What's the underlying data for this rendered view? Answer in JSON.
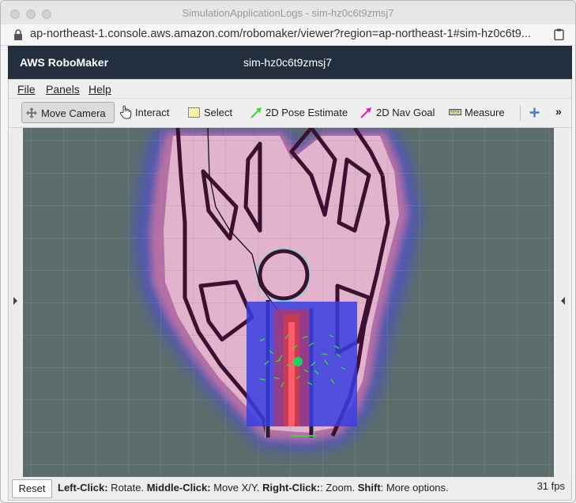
{
  "window": {
    "title": "SimulationApplicationLogs - sim-hz0c6t9zmsj7"
  },
  "address_bar": {
    "url": "ap-northeast-1.console.aws.amazon.com/robomaker/viewer?region=ap-northeast-1#sim-hz0c6t9..."
  },
  "header": {
    "brand": "AWS RoboMaker",
    "simulation": "sim-hz0c6t9zmsj7"
  },
  "menubar": {
    "items": [
      {
        "label": "File"
      },
      {
        "label": "Panels"
      },
      {
        "label": "Help"
      }
    ]
  },
  "toolbar": {
    "tools": [
      {
        "label": "Move Camera",
        "active": true
      },
      {
        "label": "Interact"
      },
      {
        "label": "Select"
      },
      {
        "label": "2D Pose Estimate"
      },
      {
        "label": "2D Nav Goal"
      },
      {
        "label": "Measure"
      }
    ],
    "add_icon": "plus-icon",
    "overflow": "»"
  },
  "colors": {
    "pose_arrow": "#33dd33",
    "nav_arrow": "#e020c0",
    "header_bg": "#232f3e",
    "grid_bg": "#5c6e6b"
  },
  "statusbar": {
    "reset": "Reset",
    "hint": [
      {
        "key": "Left-Click:",
        "text": " Rotate. "
      },
      {
        "key": "Middle-Click:",
        "text": " Move X/Y. "
      },
      {
        "key": "Right-Click:",
        "text": ": Zoom. "
      },
      {
        "key": "Shift",
        "text": ": More options."
      }
    ],
    "fps": "31 fps"
  }
}
